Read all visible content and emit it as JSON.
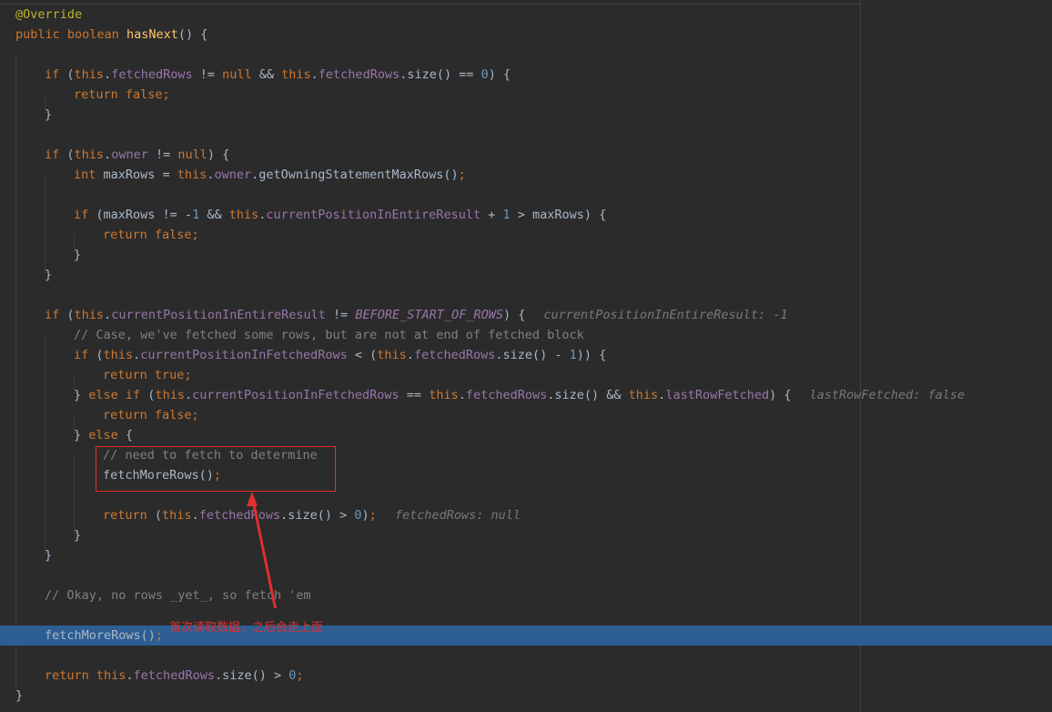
{
  "code": {
    "annotation": "@Override",
    "method_signature_kw": "public boolean",
    "method_name": "hasNext",
    "method_tail": "() {",
    "comment_case": "// Case, we've fetched some rows, but are not at end of fetched block",
    "comment_need_fetch": "// need to fetch to determine",
    "comment_okay": "// Okay, no rows _yet_, so fetch 'em",
    "fetch_call": "fetchMoreRows();",
    "return_final": "return this.fetchedRows.size() > 0;"
  },
  "inline_hints": {
    "current_position": "currentPositionInEntireResult: -1",
    "last_row_fetched": "lastRowFetched: false",
    "fetched_rows": "fetchedRows: null"
  },
  "annotation_note": "首次读取数据，之后会走上面",
  "colors": {
    "background": "#2b2b2b",
    "highlight_line": "#2d5e93",
    "callout": "#e03030"
  }
}
